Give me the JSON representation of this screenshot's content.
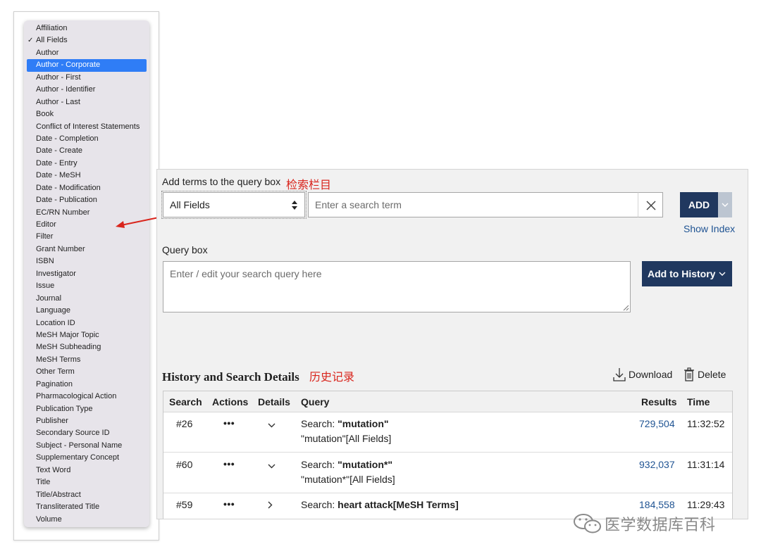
{
  "field_dropdown": {
    "selected": "All Fields",
    "highlighted": "Author - Corporate",
    "options": [
      "Affiliation",
      "All Fields",
      "Author",
      "Author - Corporate",
      "Author - First",
      "Author - Identifier",
      "Author - Last",
      "Book",
      "Conflict of Interest Statements",
      "Date - Completion",
      "Date - Create",
      "Date - Entry",
      "Date - MeSH",
      "Date - Modification",
      "Date - Publication",
      "EC/RN Number",
      "Editor",
      "Filter",
      "Grant Number",
      "ISBN",
      "Investigator",
      "Issue",
      "Journal",
      "Language",
      "Location ID",
      "MeSH Major Topic",
      "MeSH Subheading",
      "MeSH Terms",
      "Other Term",
      "Pagination",
      "Pharmacological Action",
      "Publication Type",
      "Publisher",
      "Secondary Source ID",
      "Subject - Personal Name",
      "Supplementary Concept",
      "Text Word",
      "Title",
      "Title/Abstract",
      "Transliterated Title",
      "Volume"
    ],
    "check_mark": "✓"
  },
  "builder": {
    "add_terms_label": "Add terms to the query box",
    "add_terms_note": "检索栏目",
    "field_value": "All Fields",
    "term_placeholder": "Enter a search term",
    "add_label": "ADD",
    "show_index": "Show Index",
    "query_box_label": "Query box",
    "query_placeholder": "Enter / edit your search query here",
    "add_history_label": "Add to History"
  },
  "history": {
    "title": "History and Search Details",
    "note": "历史记录",
    "download_label": "Download",
    "delete_label": "Delete",
    "columns": [
      "Search",
      "Actions",
      "Details",
      "Query",
      "Results",
      "Time"
    ],
    "rows": [
      {
        "search": "#26",
        "actions": "•••",
        "details": "expanded",
        "query_prefix": "Search: ",
        "query_term": "\"mutation\"",
        "query_detail": "\"mutation\"[All Fields]",
        "results": "729,504",
        "time": "11:32:52"
      },
      {
        "search": "#60",
        "actions": "•••",
        "details": "expanded",
        "query_prefix": "Search: ",
        "query_term": "\"mutation*\"",
        "query_detail": "\"mutation*\"[All Fields]",
        "results": "932,037",
        "time": "11:31:14"
      },
      {
        "search": "#59",
        "actions": "•••",
        "details": "collapsed",
        "query_prefix": "Search: ",
        "query_term": "heart attack[MeSH Terms]",
        "query_detail": "",
        "results": "184,558",
        "time": "11:29:43"
      }
    ]
  },
  "watermark": {
    "text": "医学数据库百科"
  },
  "colors": {
    "accent_dark": "#20385f",
    "link": "#205493",
    "highlight": "#2f7df6",
    "annotation": "#d9251d"
  }
}
